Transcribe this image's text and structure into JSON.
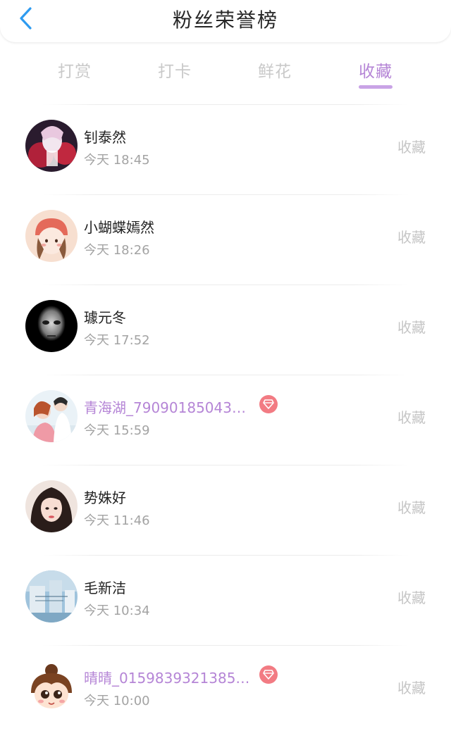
{
  "header": {
    "title": "粉丝荣誉榜",
    "back_icon": "chevron-left-icon"
  },
  "colors": {
    "accent": "#b585d6",
    "underline": "#c9a3e6",
    "badge": "#f27b83",
    "back_arrow": "#2e9bf0"
  },
  "tabs": [
    {
      "label": "打赏",
      "active": false
    },
    {
      "label": "打卡",
      "active": false
    },
    {
      "label": "鲜花",
      "active": false
    },
    {
      "label": "收藏",
      "active": true
    }
  ],
  "fans": [
    {
      "name": "钊泰然",
      "time": "今天 18:45",
      "action": "收藏",
      "vip": false
    },
    {
      "name": "小蝴蝶嫣然",
      "time": "今天 18:26",
      "action": "收藏",
      "vip": false
    },
    {
      "name": "璩元冬",
      "time": "今天 17:52",
      "action": "收藏",
      "vip": false
    },
    {
      "name": "青海湖_790901850434...",
      "time": "今天 15:59",
      "action": "收藏",
      "vip": true,
      "badge_icon": "diamond-icon"
    },
    {
      "name": "势姝好",
      "time": "今天 11:46",
      "action": "收藏",
      "vip": false
    },
    {
      "name": "毛新洁",
      "time": "今天 10:34",
      "action": "收藏",
      "vip": false
    },
    {
      "name": "晴晴_01598393213850...",
      "time": "今天 10:00",
      "action": "收藏",
      "vip": true,
      "badge_icon": "diamond-icon"
    }
  ]
}
